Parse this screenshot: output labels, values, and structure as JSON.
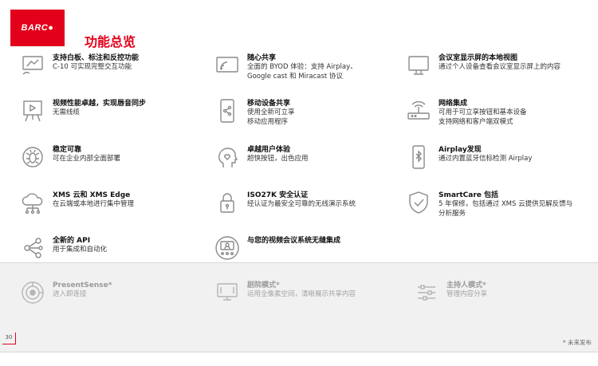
{
  "brand": {
    "logo_text": "BARC●",
    "accent": "#e2001a"
  },
  "page_title": "功能总览",
  "features": [
    {
      "title": "支持白板、标注和反控功能",
      "desc": [
        "C-10 可实现完整交互功能"
      ],
      "icon": "whiteboard-touch-icon"
    },
    {
      "title": "随心共享",
      "desc": [
        "全面的 BYOD 体验：支持 Airplay、",
        "Google cast 和 Miracast 协议"
      ],
      "icon": "wireless-share-icon"
    },
    {
      "title": "会议室显示屏的本地视图",
      "desc": [
        "通过个人设备查看会议室显示屏上的内容"
      ],
      "icon": "monitor-icon"
    },
    {
      "title": "视频性能卓越，实现唇音同步",
      "desc": [
        "无需线缆"
      ],
      "icon": "video-easel-icon"
    },
    {
      "title": "移动设备共享",
      "desc": [
        "使用全新可立享",
        "移动应用程序"
      ],
      "icon": "mobile-share-icon"
    },
    {
      "title": "网络集成",
      "desc": [
        "可用于可立享按钮和基本设备",
        "支持网络和客户端双模式"
      ],
      "icon": "router-icon"
    },
    {
      "title": "稳定可靠",
      "desc": [
        "可在企业内部全面部署"
      ],
      "icon": "bug-shield-icon"
    },
    {
      "title": "卓越用户体验",
      "desc": [
        "超快按钮，出色应用"
      ],
      "icon": "head-heart-icon"
    },
    {
      "title": "Airplay发现",
      "desc": [
        "通过内置蓝牙信标检测 Airplay"
      ],
      "icon": "bluetooth-phone-icon"
    },
    {
      "title": "XMS 云和 XMS Edge",
      "desc": [
        "在云端或本地进行集中管理"
      ],
      "icon": "cloud-network-icon"
    },
    {
      "title": "ISO27K 安全认证",
      "desc": [
        "经认证为最安全可靠的无线演示系统"
      ],
      "icon": "padlock-icon"
    },
    {
      "title": "SmartCare 包括",
      "desc": [
        "5 年保修，包括通过 XMS 云提供见解反馈与",
        "分析服务"
      ],
      "icon": "shield-check-icon"
    },
    {
      "title": "全新的 API",
      "desc": [
        "用于集成和自动化"
      ],
      "icon": "api-nodes-icon"
    },
    {
      "title": "与您的视频会议系统无缝集成",
      "desc": [],
      "icon": "video-conference-icon"
    }
  ],
  "future_features": [
    {
      "title": "PresentSense*",
      "desc": [
        "进入即连接"
      ],
      "icon": "presence-target-icon"
    },
    {
      "title": "剧院模式*",
      "desc": [
        "运用全像素空间，清晰展示共享内容"
      ],
      "icon": "theater-screen-icon"
    },
    {
      "title": "主持人模式*",
      "desc": [
        "管理内容分享"
      ],
      "icon": "sliders-icon"
    }
  ],
  "footer": {
    "page_number": "30",
    "footnote": "* 未来发布"
  }
}
